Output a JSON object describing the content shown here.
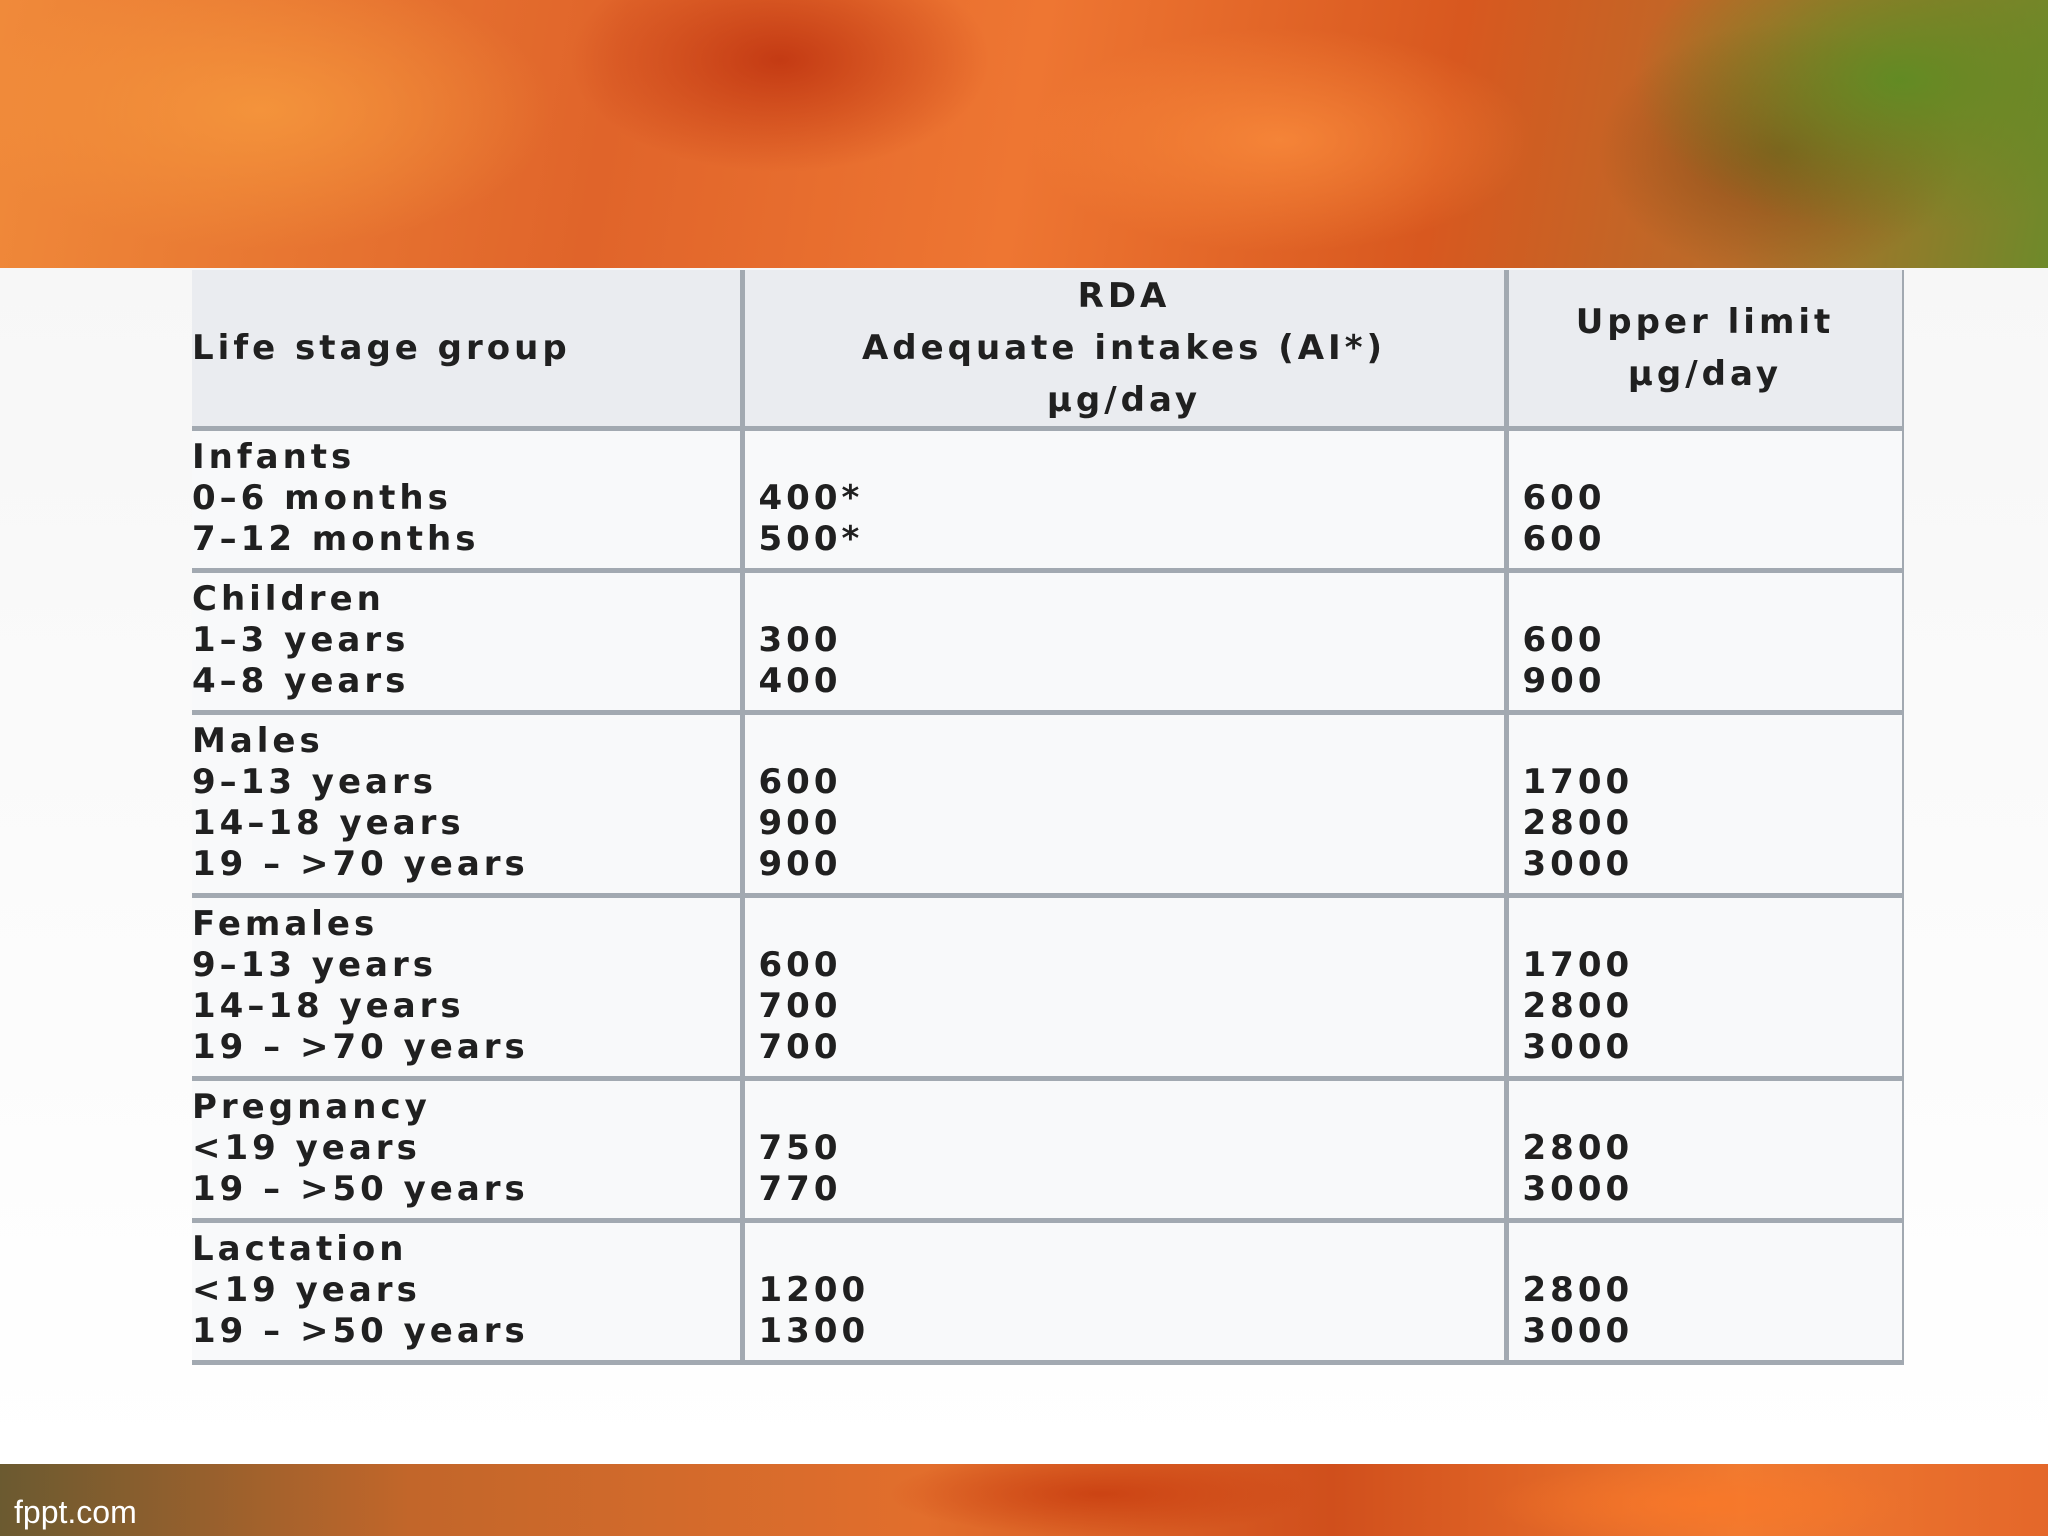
{
  "slide": {
    "footer_brand": "fppt.com"
  },
  "table": {
    "headers": {
      "col1": "Life stage group",
      "col2_line1": "RDA",
      "col2_line2": "Adequate intakes (AI*)",
      "col2_line3": "µg/day",
      "col3_line1": "Upper limit",
      "col3_line2": "µg/day"
    },
    "groups": [
      {
        "name": "Infants",
        "rows": [
          {
            "age": "0–6 months",
            "rda": "400*",
            "ul": "600"
          },
          {
            "age": "7–12 months",
            "rda": "500*",
            "ul": "600"
          }
        ]
      },
      {
        "name": "Children",
        "rows": [
          {
            "age": "1–3 years",
            "rda": "300",
            "ul": "600"
          },
          {
            "age": "4–8 years",
            "rda": "400",
            "ul": "900"
          }
        ]
      },
      {
        "name": "Males",
        "rows": [
          {
            "age": "9–13 years",
            "rda": "600",
            "ul": "1700"
          },
          {
            "age": "14–18 years",
            "rda": "900",
            "ul": "2800"
          },
          {
            "age": "19 – >70 years",
            "rda": "900",
            "ul": "3000"
          }
        ]
      },
      {
        "name": "Females",
        "rows": [
          {
            "age": "9–13 years",
            "rda": "600",
            "ul": "1700"
          },
          {
            "age": "14–18 years",
            "rda": "700",
            "ul": "2800"
          },
          {
            "age": "19 – >70 years",
            "rda": "700",
            "ul": "3000"
          }
        ]
      },
      {
        "name": "Pregnancy",
        "rows": [
          {
            "age": "<19 years",
            "rda": "750",
            "ul": "2800"
          },
          {
            "age": "19 – >50 years",
            "rda": "770",
            "ul": "3000"
          }
        ]
      },
      {
        "name": "Lactation",
        "rows": [
          {
            "age": "<19 years",
            "rda": "1200",
            "ul": "2800"
          },
          {
            "age": "19 – >50 years",
            "rda": "1300",
            "ul": "3000"
          }
        ]
      }
    ]
  }
}
